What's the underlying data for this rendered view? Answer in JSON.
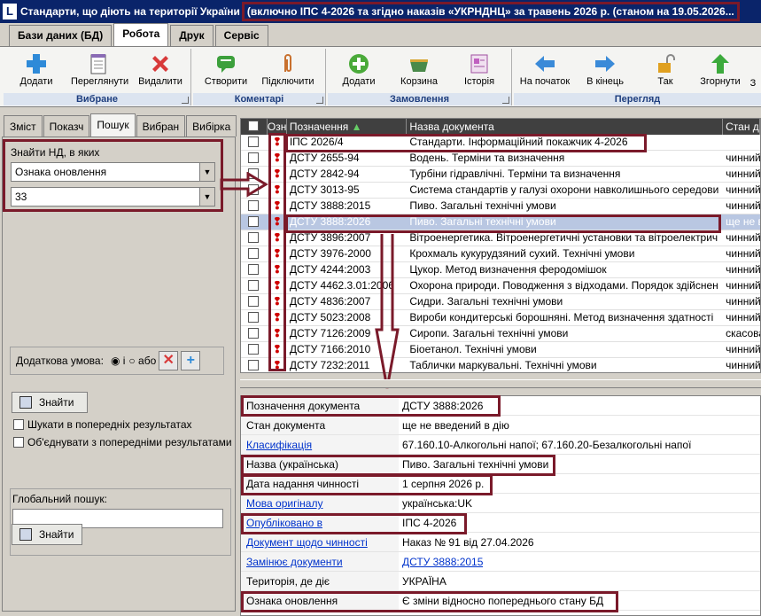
{
  "window": {
    "title": "Стандарти, що діють на території України",
    "title_highlight": "(включно ІПС 4-2026  та згідно наказів «УКРНДНЦ» за травень 2026 р. (станом  на 19.05.2026..."
  },
  "ribbon_tabs": [
    "Бази даних (БД)",
    "Робота",
    "Друк",
    "Сервіс"
  ],
  "ribbon_groups": [
    {
      "title": "Вибране",
      "buttons": [
        "Додати",
        "Переглянути",
        "Видалити"
      ]
    },
    {
      "title": "Коментарі",
      "buttons": [
        "Створити",
        "Підключити"
      ]
    },
    {
      "title": "Замовлення",
      "buttons": [
        "Додати",
        "Корзина",
        "Історія"
      ]
    },
    {
      "title": "Перегляд",
      "buttons": [
        "На початок",
        "В кінець",
        "Так",
        "Згорнути",
        "З"
      ]
    }
  ],
  "left": {
    "tabs": [
      "Зміст",
      "Показч",
      "Пошук",
      "Вибран",
      "Вибірка"
    ],
    "find_label": "Знайти НД, в яких",
    "field_value": "Ознака оновлення",
    "value2": "33",
    "dop_label": "Додаткова умова:",
    "radio_and": "і",
    "radio_or": "або",
    "find_button": "Знайти",
    "check1": "Шукати в попередніх результатах",
    "check2": "Об'єднувати з попередніми результатами",
    "global_label": "Глобальний пошук:",
    "global_value": "",
    "find_button2": "Знайти"
  },
  "table": {
    "headers": [
      "Озн",
      "Позначення",
      "Назва документа",
      "Стан до"
    ],
    "rows": [
      {
        "code": "ІПС 2026/4",
        "name": "Стандарти. Інформаційний покажчик 4-2026",
        "state": ""
      },
      {
        "code": "ДСТУ 2655-94",
        "name": "Водень. Терміни та визначення",
        "state": "чинний"
      },
      {
        "code": "ДСТУ 2842-94",
        "name": "Турбіни гідравлічні. Терміни та визначення",
        "state": "чинний"
      },
      {
        "code": "ДСТУ 3013-95",
        "name": "Система стандартів у галузі охорони навколишнього середови",
        "state": "чинний"
      },
      {
        "code": "ДСТУ 3888:2015",
        "name": "Пиво. Загальні технічні умови",
        "state": "чинний"
      },
      {
        "code": "ДСТУ 3888:2026",
        "name": "Пиво. Загальні технічні умови",
        "state": "ще не в"
      },
      {
        "code": "ДСТУ 3896:2007",
        "name": "Вітроенергетика. Вітроенергетичні установки та вітроелектрич",
        "state": "чинний"
      },
      {
        "code": "ДСТУ 3976-2000",
        "name": "Крохмаль кукурудзяний сухий. Технічні умови",
        "state": "чинний"
      },
      {
        "code": "ДСТУ 4244:2003",
        "name": "Цукор. Метод визначення феродомішок",
        "state": "чинний"
      },
      {
        "code": "ДСТУ 4462.3.01:2006",
        "name": "Охорона природи. Поводження з відходами. Порядок здійснен",
        "state": "чинний"
      },
      {
        "code": "ДСТУ 4836:2007",
        "name": "Сидри. Загальні технічні умови",
        "state": "чинний"
      },
      {
        "code": "ДСТУ 5023:2008",
        "name": "Вироби кондитерські борошняні. Метод визначення здатності",
        "state": "чинний"
      },
      {
        "code": "ДСТУ 7126:2009",
        "name": "Сиропи. Загальні технічні умови",
        "state": "скасова"
      },
      {
        "code": "ДСТУ 7166:2010",
        "name": "Біоетанол. Технічні умови",
        "state": "чинний"
      },
      {
        "code": "ДСТУ 7232:2011",
        "name": "Таблички маркувальні. Технічні умови",
        "state": "чинний"
      }
    ]
  },
  "details": [
    {
      "key": "Позначення документа",
      "value": "ДСТУ 3888:2026",
      "link_key": false,
      "link_val": false
    },
    {
      "key": "Стан документа",
      "value": "ще не введений в дію",
      "link_key": false,
      "link_val": false
    },
    {
      "key": "Класифікація",
      "value": "67.160.10-Алкогольні напої; 67.160.20-Безалкогольні напої",
      "link_key": true,
      "link_val": false
    },
    {
      "key": "Назва (українська)",
      "value": "Пиво. Загальні технічні умови",
      "link_key": false,
      "link_val": false
    },
    {
      "key": "Дата надання чинності",
      "value": "1 серпня 2026 р.",
      "link_key": false,
      "link_val": false
    },
    {
      "key": "Мова оригіналу",
      "value": "українська:UK",
      "link_key": true,
      "link_val": false
    },
    {
      "key": "Опубліковано в",
      "value": "ІПС 4-2026",
      "link_key": true,
      "link_val": false
    },
    {
      "key": "Документ щодо чинності",
      "value": "Наказ № 91 від 27.04.2026",
      "link_key": true,
      "link_val": false
    },
    {
      "key": "Замінює документи",
      "value": "ДСТУ 3888:2015",
      "link_key": true,
      "link_val": true
    },
    {
      "key": "Територія, де діє",
      "value": "УКРАЇНА",
      "link_key": false,
      "link_val": false
    },
    {
      "key": "Ознака оновлення",
      "value": "Є зміни відносно попереднього стану БД",
      "link_key": false,
      "link_val": false
    }
  ],
  "colors": {
    "accent": "#0a246a",
    "highlight": "#7a1a2a",
    "mark": "#d00000",
    "selected": "#b9c7e2"
  }
}
